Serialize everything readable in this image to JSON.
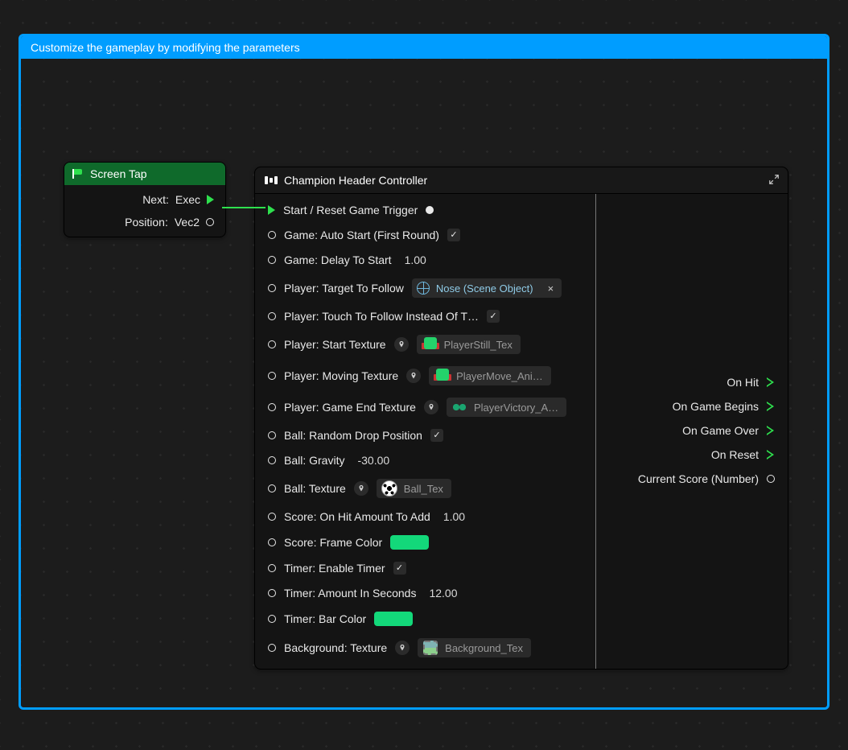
{
  "panel": {
    "title": "Customize the gameplay by modifying the parameters"
  },
  "screenTap": {
    "title": "Screen Tap",
    "next": {
      "label": "Next:",
      "type": "Exec"
    },
    "position": {
      "label": "Position:",
      "type": "Vec2"
    }
  },
  "champion": {
    "title": "Champion Header Controller",
    "inputs": {
      "start_reset": {
        "label": "Start / Reset Game Trigger"
      },
      "auto_start": {
        "label": "Game: Auto Start (First Round)",
        "checked": true
      },
      "delay_to_start": {
        "label": "Game: Delay To Start",
        "value": "1.00"
      },
      "target_to_follow": {
        "label": "Player: Target To Follow",
        "chip": "Nose (Scene Object)"
      },
      "touch_to_follow": {
        "label": "Player: Touch To Follow Instead Of T…",
        "checked": true
      },
      "start_texture": {
        "label": "Player: Start Texture",
        "chip": "PlayerStill_Tex"
      },
      "moving_texture": {
        "label": "Player: Moving Texture",
        "chip": "PlayerMove_Ani…"
      },
      "game_end_texture": {
        "label": "Player: Game End Texture",
        "chip": "PlayerVictory_A…"
      },
      "ball_random_drop": {
        "label": "Ball: Random Drop Position",
        "checked": true
      },
      "ball_gravity": {
        "label": "Ball: Gravity",
        "value": "-30.00"
      },
      "ball_texture": {
        "label": "Ball: Texture",
        "chip": "Ball_Tex"
      },
      "score_on_hit": {
        "label": "Score: On Hit Amount To Add",
        "value": "1.00"
      },
      "score_frame_color": {
        "label": "Score: Frame Color",
        "color": "#13d87a"
      },
      "timer_enable": {
        "label": "Timer: Enable Timer",
        "checked": true
      },
      "timer_amount": {
        "label": "Timer: Amount In Seconds",
        "value": "12.00"
      },
      "timer_bar_color": {
        "label": "Timer: Bar Color",
        "color": "#13d87a"
      },
      "background_texture": {
        "label": "Background: Texture",
        "chip": "Background_Tex"
      }
    },
    "outputs": {
      "on_hit": {
        "label": "On Hit"
      },
      "on_game_begins": {
        "label": "On Game Begins"
      },
      "on_game_over": {
        "label": "On Game Over"
      },
      "on_reset": {
        "label": "On Reset"
      },
      "current_score": {
        "label": "Current Score (Number)"
      }
    }
  }
}
